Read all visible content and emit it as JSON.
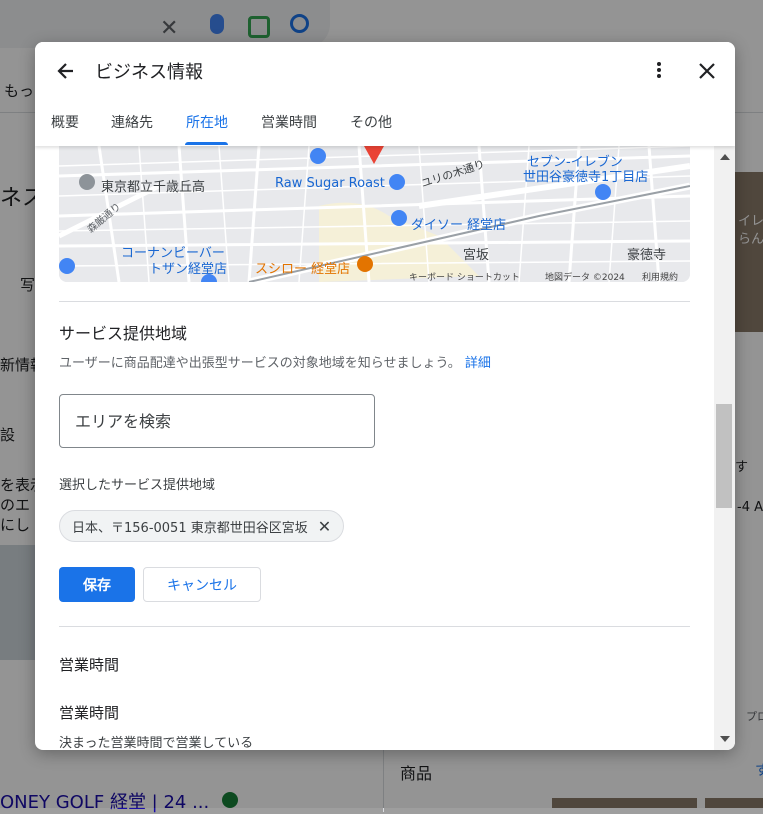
{
  "background": {
    "left_text": [
      "もっ",
      "ネス",
      "写",
      "新情報",
      "設",
      "を表示",
      "のエ",
      "にし"
    ],
    "right_text": [
      "す",
      "-4 A",
      "プロ",
      "イレ",
      "らん",
      "す"
    ],
    "products_label": "商品",
    "bottom_business": "ONEY GOLF 経堂 | 24 ..."
  },
  "dialog": {
    "title": "ビジネス情報",
    "tabs": [
      {
        "label": "概要"
      },
      {
        "label": "連絡先"
      },
      {
        "label": "所在地",
        "active": true
      },
      {
        "label": "営業時間"
      },
      {
        "label": "その他"
      }
    ]
  },
  "map": {
    "labels": {
      "school": "東京都立千歳丘高",
      "cafe": "Raw Sugar Roast",
      "seven": "セブン-イレブン",
      "seven2": "世田谷豪徳寺1丁目店",
      "street": "ユリの木通り",
      "daiso": "ダイソー 経堂店",
      "konan1": "コーナンビーバー",
      "konan2": "トザン経堂店",
      "sushiro": "スシロー 経堂店",
      "miyasaka": "宮坂",
      "gotokuji": "豪徳寺",
      "road": "森厳通り"
    },
    "footer": {
      "shortcuts": "キーボード ショートカット",
      "data": "地図データ ©2024",
      "terms": "利用規約"
    }
  },
  "service_area": {
    "title": "サービス提供地域",
    "description": "ユーザーに商品配達や出張型サービスの対象地域を知らせましょう。",
    "link": "詳細",
    "input_placeholder": "エリアを検索",
    "selected_label": "選択したサービス提供地域",
    "chip": "日本、〒156-0051 東京都世田谷区宮坂",
    "save": "保存",
    "cancel": "キャンセル"
  },
  "hours": {
    "section_title": "営業時間",
    "sub_title": "営業時間",
    "sub_desc": "決まった営業時間で営業している"
  },
  "colors": {
    "accent": "#1a73e8",
    "pin": "#ea4335",
    "poi_blue": "#4285f4",
    "poi_orange": "#e37400"
  }
}
